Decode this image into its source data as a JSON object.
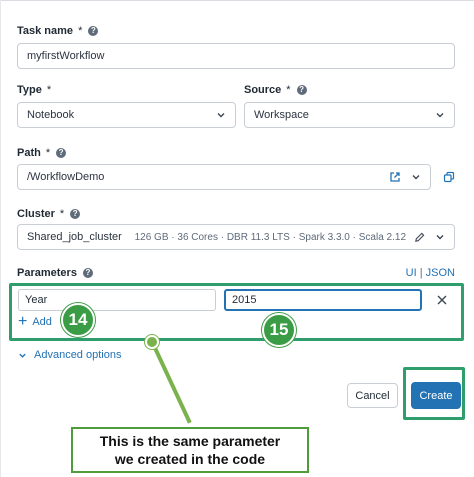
{
  "task_name": {
    "label": "Task name",
    "required_mark": "*",
    "help_icon": "?",
    "value": "myfirstWorkflow"
  },
  "type": {
    "label": "Type",
    "required_mark": "*",
    "value": "Notebook"
  },
  "source": {
    "label": "Source",
    "required_mark": "*",
    "help_icon": "?",
    "value": "Workspace"
  },
  "path": {
    "label": "Path",
    "required_mark": "*",
    "help_icon": "?",
    "value": "/WorkflowDemo"
  },
  "cluster": {
    "label": "Cluster",
    "required_mark": "*",
    "help_icon": "?",
    "value": "Shared_job_cluster",
    "details": "126 GB · 36 Cores · DBR 11.3 LTS · Spark 3.3.0 · Scala 2.12"
  },
  "parameters": {
    "label": "Parameters",
    "help_icon": "?",
    "ui_link": "UI",
    "separator": "|",
    "json_link": "JSON",
    "rows": [
      {
        "key": "Year",
        "value": "2015"
      }
    ],
    "add_label": "Add",
    "add_icon": "+"
  },
  "advanced_options": {
    "label": "Advanced options"
  },
  "buttons": {
    "cancel": "Cancel",
    "create": "Create"
  },
  "annotations": {
    "badge_add": "14",
    "badge_value": "15",
    "callout_line1": "This is the same parameter",
    "callout_line2": "we created in the code"
  },
  "colors": {
    "accent_blue": "#2272b4",
    "annotation_green": "#2f9e6c",
    "badge_green": "#3a9c44"
  }
}
